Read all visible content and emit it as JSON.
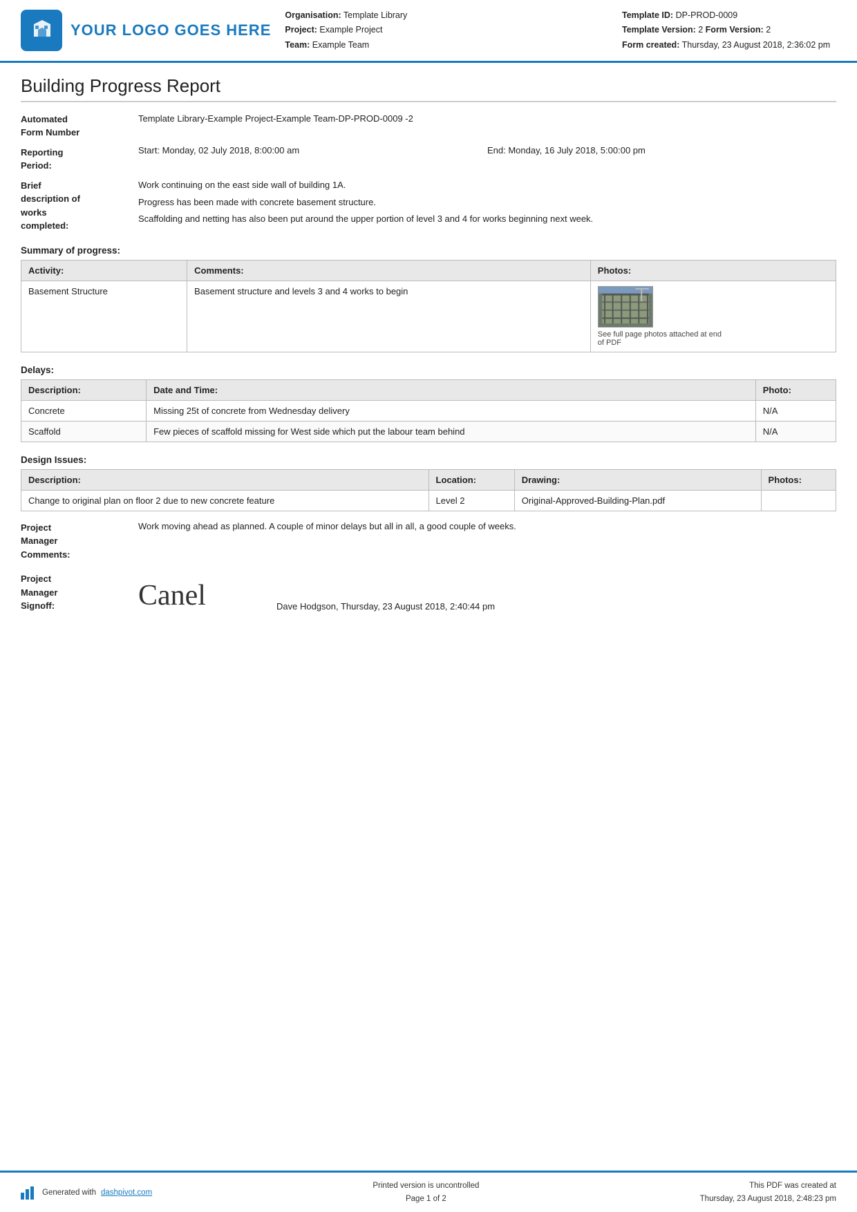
{
  "header": {
    "logo_text": "YOUR LOGO GOES HERE",
    "org_label": "Organisation:",
    "org_value": "Template Library",
    "project_label": "Project:",
    "project_value": "Example Project",
    "team_label": "Team:",
    "team_value": "Example Team",
    "template_id_label": "Template ID:",
    "template_id_value": "DP-PROD-0009",
    "template_version_label": "Template Version:",
    "template_version_value": "2",
    "form_version_label": "Form Version:",
    "form_version_value": "2",
    "form_created_label": "Form created:",
    "form_created_value": "Thursday, 23 August 2018, 2:36:02 pm"
  },
  "report": {
    "title": "Building Progress Report",
    "form_number_label": "Automated\nForm Number",
    "form_number_value": "Template Library-Example Project-Example Team-DP-PROD-0009   -2",
    "reporting_period_label": "Reporting\nPeriod:",
    "reporting_start": "Start: Monday, 02 July 2018, 8:00:00 am",
    "reporting_end": "End: Monday, 16 July 2018, 5:00:00 pm",
    "brief_desc_label": "Brief\ndescription of\nworks\ncompleted:",
    "brief_desc_lines": [
      "Work continuing on the east side wall of building 1A.",
      "Progress has been made with concrete basement structure.",
      "Scaffolding and netting has also been put around the upper portion of level 3 and 4 for works beginning next week."
    ]
  },
  "summary": {
    "title": "Summary of progress:",
    "columns": [
      "Activity:",
      "Comments:",
      "Photos:"
    ],
    "rows": [
      {
        "activity": "Basement Structure",
        "comments": "Basement structure and levels 3 and 4 works to begin",
        "photo_caption": "See full page photos attached at end of PDF"
      }
    ]
  },
  "delays": {
    "title": "Delays:",
    "columns": [
      "Description:",
      "Date and Time:",
      "Photo:"
    ],
    "rows": [
      {
        "description": "Concrete",
        "date_time": "Missing 25t of concrete from Wednesday delivery",
        "photo": "N/A"
      },
      {
        "description": "Scaffold",
        "date_time": "Few pieces of scaffold missing for West side which put the labour team behind",
        "photo": "N/A"
      }
    ]
  },
  "design_issues": {
    "title": "Design Issues:",
    "columns": [
      "Description:",
      "Location:",
      "Drawing:",
      "Photos:"
    ],
    "rows": [
      {
        "description": "Change to original plan on floor 2 due to new concrete feature",
        "location": "Level 2",
        "drawing": "Original-Approved-Building-Plan.pdf",
        "photos": ""
      }
    ]
  },
  "pm_comments": {
    "label": "Project\nManager\nComments:",
    "value": "Work moving ahead as planned. A couple of minor delays but all in all, a good couple of weeks."
  },
  "pm_signoff": {
    "label": "Project\nManager\nSignoff:",
    "signature_display": "Canel",
    "signoff_info": "Dave Hodgson, Thursday, 23 August 2018, 2:40:44 pm"
  },
  "footer": {
    "generated_text": "Generated with",
    "generated_link": "dashpivot.com",
    "page_text": "Printed version is uncontrolled",
    "page_number": "Page 1 of 2",
    "pdf_text": "This PDF was created at",
    "pdf_date": "Thursday, 23 August 2018, 2:48:23 pm"
  }
}
